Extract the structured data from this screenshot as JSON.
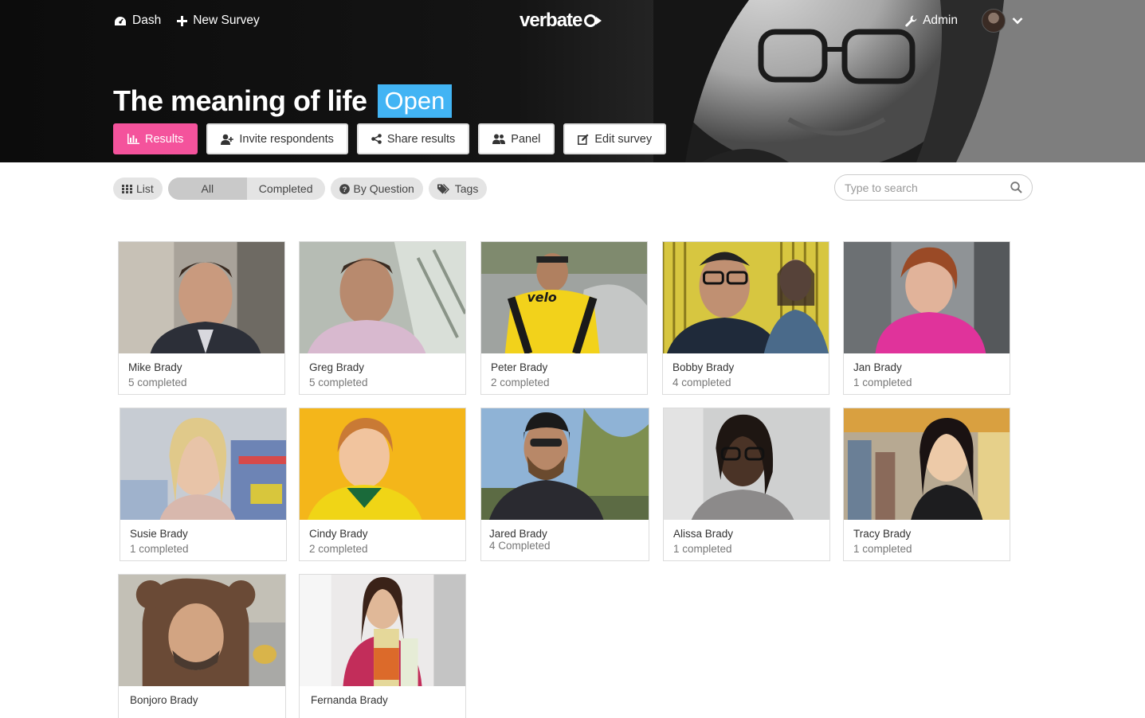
{
  "nav": {
    "dash_label": "Dash",
    "new_survey_label": "New Survey",
    "logo_text": "verbate",
    "admin_label": "Admin"
  },
  "survey": {
    "title": "The meaning of life",
    "status": "Open"
  },
  "actions": {
    "results": "Results",
    "invite": "Invite respondents",
    "share": "Share results",
    "panel": "Panel",
    "edit": "Edit survey"
  },
  "filters": {
    "list": "List",
    "all": "All",
    "completed": "Completed",
    "by_question": "By Question",
    "tags": "Tags"
  },
  "search": {
    "placeholder": "Type to search"
  },
  "colors": {
    "accent_pink": "#f4539c",
    "status_blue": "#42b4f4"
  },
  "respondents": [
    {
      "name": "Mike Brady",
      "count": "5 completed"
    },
    {
      "name": "Greg Brady",
      "count": "5 completed"
    },
    {
      "name": "Peter Brady",
      "count": "2 completed"
    },
    {
      "name": "Bobby Brady",
      "count": "4 completed"
    },
    {
      "name": "Jan Brady",
      "count": "1 completed"
    },
    {
      "name": "Susie Brady",
      "count": "1 completed"
    },
    {
      "name": "Cindy Brady",
      "count": "2 completed"
    },
    {
      "name": "Jared Brady",
      "count": "4 Completed"
    },
    {
      "name": "Alissa Brady",
      "count": "1 completed"
    },
    {
      "name": "Tracy Brady",
      "count": "1 completed"
    },
    {
      "name": "Bonjoro Brady",
      "count": ""
    },
    {
      "name": "Fernanda Brady",
      "count": ""
    }
  ]
}
